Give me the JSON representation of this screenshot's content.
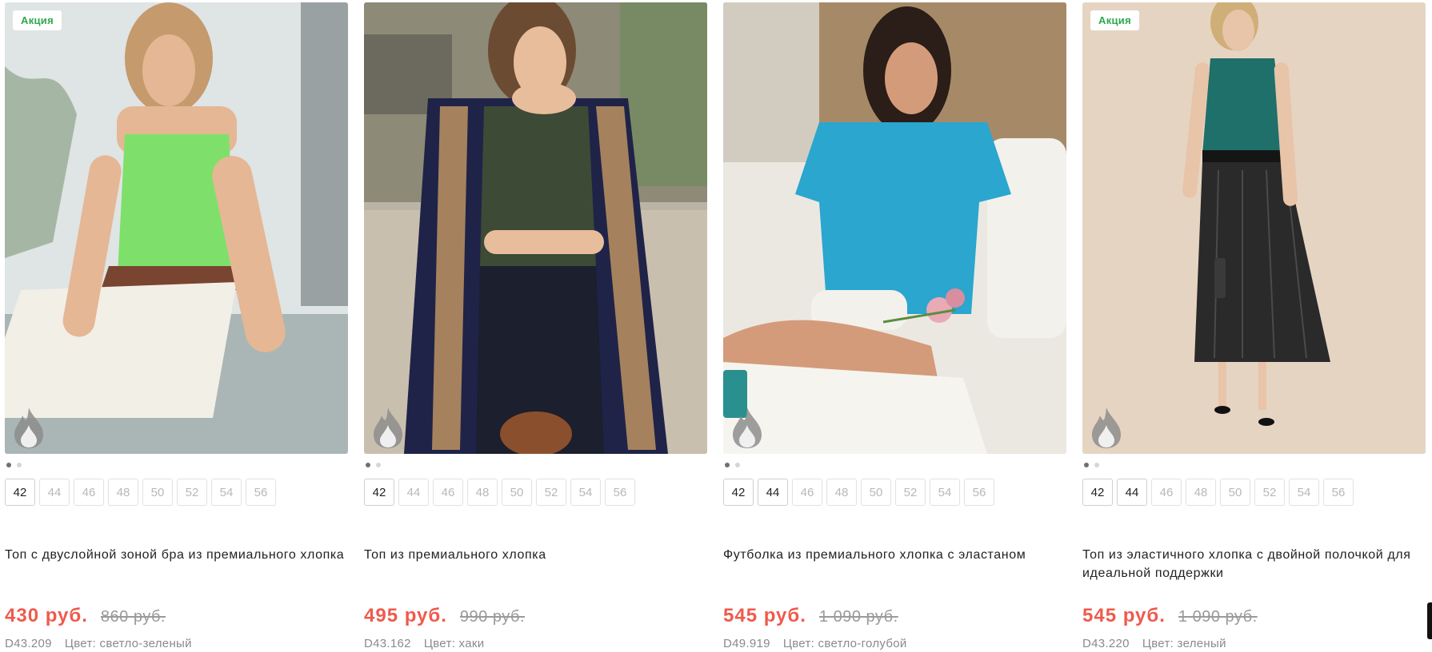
{
  "products": [
    {
      "badge": "Акция",
      "sizes": [
        "42",
        "44",
        "46",
        "48",
        "50",
        "52",
        "54",
        "56"
      ],
      "available": [
        "42"
      ],
      "title": "Топ с двуслойной зоной бра из премиального хлопка",
      "price": "430 руб.",
      "old_price": "860 руб.",
      "sku": "D43.209",
      "color_text": "Цвет: светло-зеленый",
      "garment_color": "#7ee06a"
    },
    {
      "badge": "",
      "sizes": [
        "42",
        "44",
        "46",
        "48",
        "50",
        "52",
        "54",
        "56"
      ],
      "available": [
        "42"
      ],
      "title": "Топ из премиального хлопка",
      "price": "495 руб.",
      "old_price": "990 руб.",
      "sku": "D43.162",
      "color_text": "Цвет: хаки",
      "garment_color": "#3d4a35"
    },
    {
      "badge": "",
      "sizes": [
        "42",
        "44",
        "46",
        "48",
        "50",
        "52",
        "54",
        "56"
      ],
      "available": [
        "42",
        "44"
      ],
      "title": "Футболка из премиального хлопка с эластаном",
      "price": "545 руб.",
      "old_price": "1 090 руб.",
      "sku": "D49.919",
      "color_text": "Цвет: светло-голубой",
      "garment_color": "#2aa6cf"
    },
    {
      "badge": "Акция",
      "sizes": [
        "42",
        "44",
        "46",
        "48",
        "50",
        "52",
        "54",
        "56"
      ],
      "available": [
        "42",
        "44"
      ],
      "title": "Топ из эластичного хлопка с двойной полочкой для идеальной поддержки",
      "price": "545 руб.",
      "old_price": "1 090 руб.",
      "sku": "D43.220",
      "color_text": "Цвет: зеленый",
      "garment_color": "#1f6f6a"
    }
  ],
  "colors": {
    "sale_price": "#ef5a4c",
    "promo_badge": "#2fa84f"
  }
}
